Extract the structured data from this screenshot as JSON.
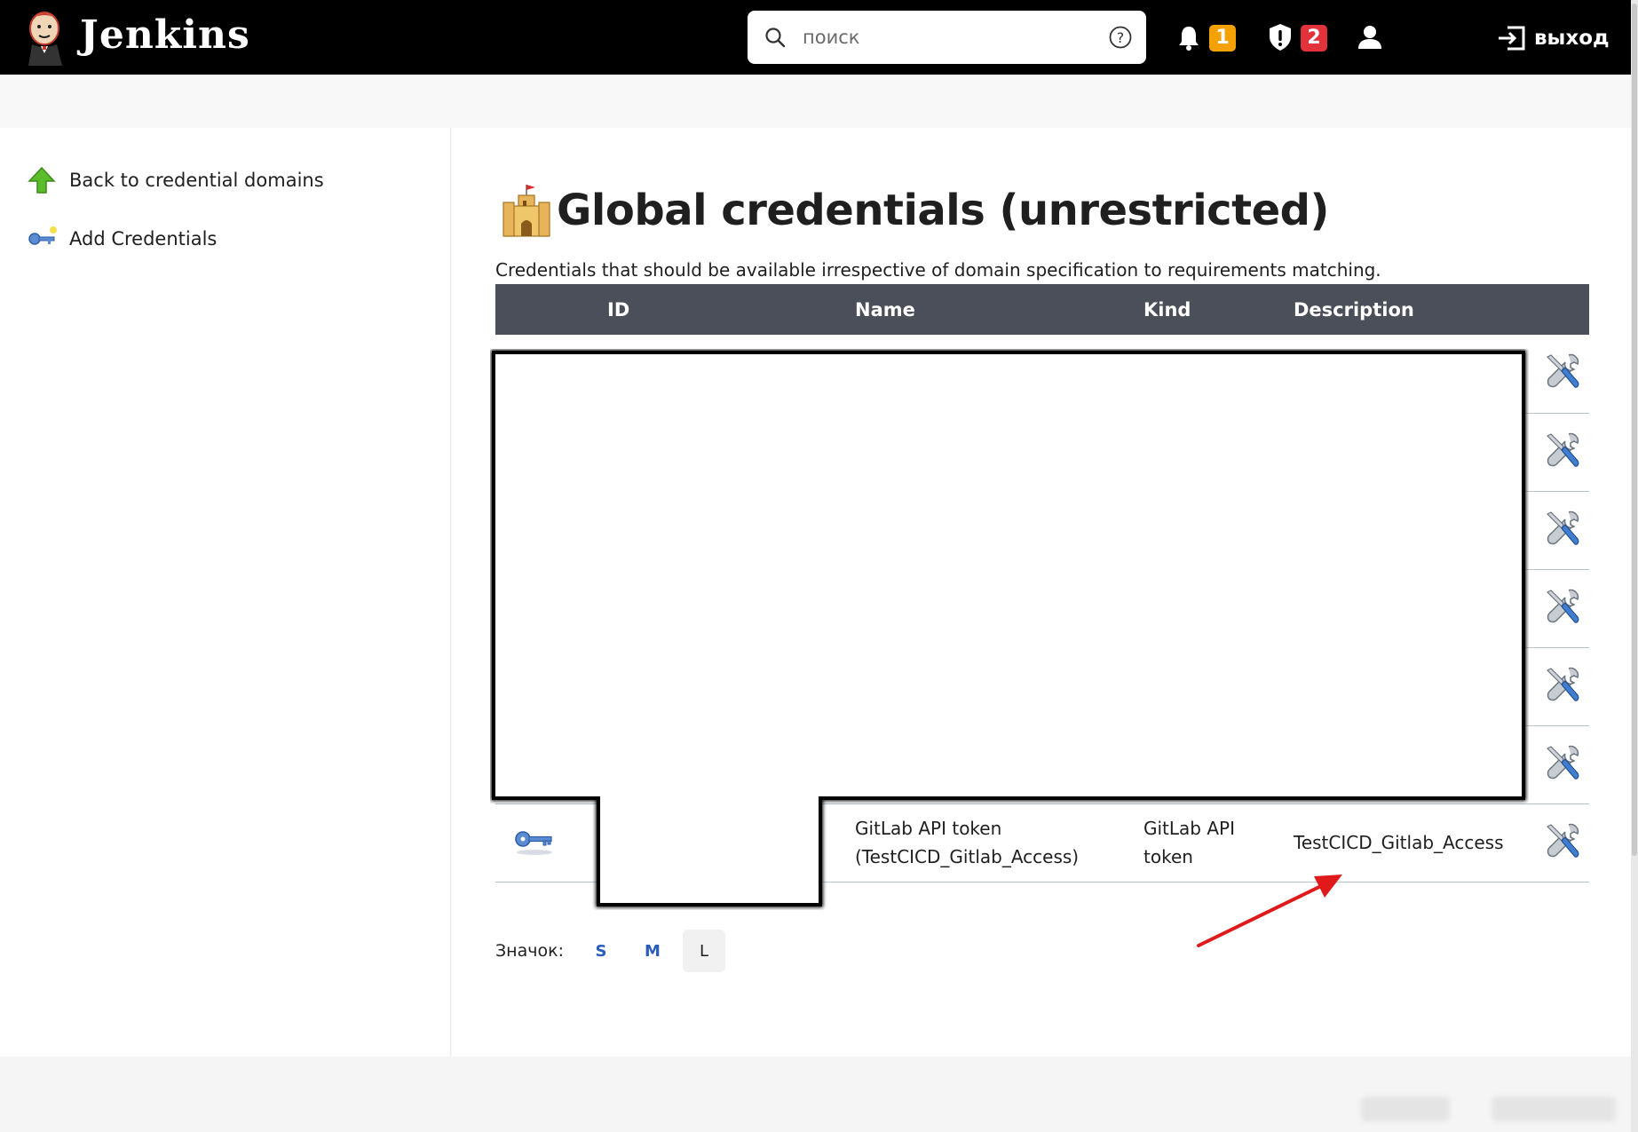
{
  "header": {
    "brand": "Jenkins",
    "search_placeholder": "поиск",
    "notifications_count": "1",
    "security_count": "2",
    "logout_label": "выход",
    "colors": {
      "bar": "#000000",
      "notif_badge": "#f3a103",
      "security_badge": "#e2323b"
    }
  },
  "sidebar": {
    "items": [
      {
        "label": "Back to credential domains",
        "icon": "arrow-up-icon"
      },
      {
        "label": "Add Credentials",
        "icon": "key-add-icon"
      }
    ]
  },
  "main": {
    "title": "Global credentials (unrestricted)",
    "title_icon": "castle-icon",
    "description": "Credentials that should be available irrespective of domain specification to requirements matching.",
    "table": {
      "headers": [
        "ID",
        "Name",
        "Kind",
        "Description"
      ],
      "rows": [
        {
          "name": "",
          "kind": "",
          "description": "",
          "redacted": true
        },
        {
          "name": "",
          "kind": "",
          "description": "",
          "redacted": true
        },
        {
          "name": "",
          "kind": "",
          "description": "",
          "redacted": true
        },
        {
          "name": "",
          "kind": "",
          "description": "",
          "redacted": true
        },
        {
          "name": "",
          "kind": "",
          "description": "",
          "redacted": true
        },
        {
          "name": "",
          "kind": "",
          "description": "",
          "redacted": true
        },
        {
          "id": "",
          "name_line1": "GitLab API token",
          "name_line2": "(TestCICD_Gitlab_Access)",
          "kind_line1": "GitLab API",
          "kind_line2": "token",
          "description": "TestCICD_Gitlab_Access",
          "icon": "key-icon"
        }
      ]
    },
    "icon_size": {
      "label": "Значок:",
      "options": [
        "S",
        "M",
        "L"
      ],
      "selected": "L"
    }
  },
  "annotation": {
    "arrow_color": "#e0191b"
  }
}
